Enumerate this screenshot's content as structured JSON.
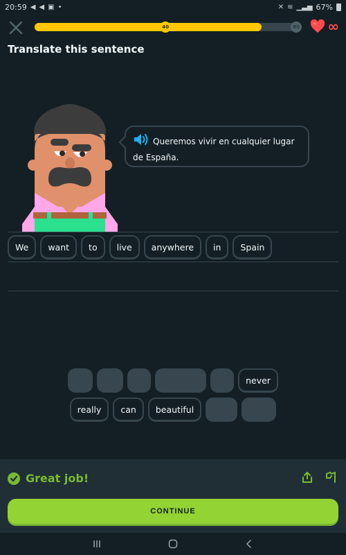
{
  "status_bar": {
    "time": "20:59",
    "left_icons": [
      "telegram-icon",
      "telegram-icon",
      "gallery-icon",
      "dot-icon"
    ],
    "right_icons": [
      "mute-icon",
      "wifi-icon",
      "signal-icon"
    ],
    "battery": "67%"
  },
  "top_bar": {
    "close_icon": "close-icon",
    "progress": {
      "fraction": 0.85,
      "milestones": [
        {
          "label": "40",
          "position": 0.49,
          "reached": true
        },
        {
          "label": "80",
          "position": 0.98,
          "reached": false
        }
      ],
      "fill_color": "#ffc800"
    },
    "hearts_icon": "heart-icon",
    "hearts_value": "∞"
  },
  "prompt": {
    "title": "Translate this sentence",
    "sentence": "Queremos vivir en cualquier lugar de España.",
    "speaker_icon": "speaker-icon"
  },
  "answer": {
    "words": [
      "We",
      "want",
      "to",
      "live",
      "anywhere",
      "in",
      "Spain"
    ]
  },
  "word_bank": {
    "row1": [
      {
        "type": "slot"
      },
      {
        "type": "slot"
      },
      {
        "type": "slot"
      },
      {
        "type": "slot",
        "wide": true
      },
      {
        "type": "slot"
      },
      {
        "type": "word",
        "label": "never"
      }
    ],
    "row2": [
      {
        "type": "word",
        "label": "really"
      },
      {
        "type": "word",
        "label": "can"
      },
      {
        "type": "word",
        "label": "beautiful"
      },
      {
        "type": "slot"
      },
      {
        "type": "slot"
      }
    ]
  },
  "feedback": {
    "title": "Great job!",
    "status": "correct",
    "accent_color": "#79b933",
    "share_icon": "share-icon",
    "flag_icon": "flag-icon",
    "continue_label": "CONTINUE",
    "button_color": "#93d333"
  },
  "nav": {
    "recents": "recents-icon",
    "home": "home-icon",
    "back": "back-icon"
  }
}
